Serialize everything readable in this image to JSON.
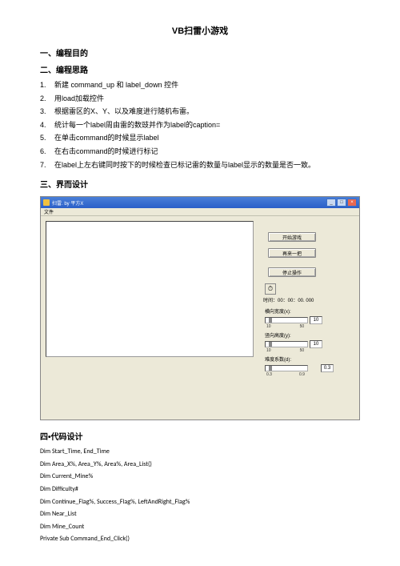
{
  "title": "VB扫雷小游戏",
  "sec1": "一、编程目的",
  "sec2": "二、编程思路",
  "steps": [
    "新建 command_up 和 label_down 控件",
    "用load加载控件",
    "根据雷区的X、Y、以及难度进行随机布雷。",
    "统计每一个label周由雷的数豉并作为label的caption=",
    "在单击command的时候显示label",
    "在右击command的时候进行标记",
    "在label上左右键同时按下的时候检查已标记雷的数量与label显示的数量是否一致。"
  ],
  "sec3": "三、界而设计",
  "window": {
    "title": "扫雷. by 平方X",
    "menu": "文件",
    "buttons": {
      "start": "开始游戏",
      "again": "再来一把",
      "stop": "停止操作"
    },
    "timer_label": "时间：00：00：00. 000",
    "opts": {
      "width": {
        "label": "横向宽度(x):",
        "val": "10",
        "ticks": [
          "10",
          "",
          "50"
        ]
      },
      "height": {
        "label": "竖向高度(y):",
        "val": "10",
        "ticks": [
          "10",
          "",
          "50"
        ]
      },
      "diff": {
        "label": "难度系数(d):",
        "val": "0.3",
        "ticks": [
          "0.3",
          "",
          "0.9"
        ]
      }
    },
    "win_icons": {
      "min": "_",
      "max": "□",
      "close": "×"
    },
    "clock": "⏱"
  },
  "sec4": "四•代码设计",
  "code": [
    "Dim Start_Time, End_Time",
    "Dim Area_X%, Area_Y%, Area%, Area_List()",
    "Dim Current_Mine%",
    "Dim Difficulty#",
    "Dim Continue_Flag%, Success_Flag%, LeftAndRight_Flag%",
    "Dim Near_List",
    "Dim Mine_Count",
    "Private Sub Command_End_Click()"
  ]
}
